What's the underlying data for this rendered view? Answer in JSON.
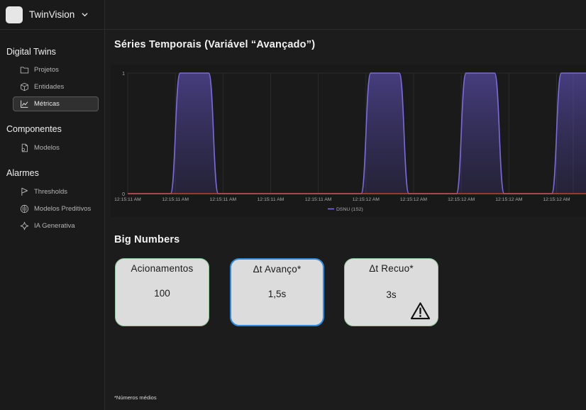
{
  "app": {
    "name": "TwinVision"
  },
  "sidebar": {
    "sections": [
      {
        "title": "Digital Twins",
        "items": [
          {
            "label": "Projetos",
            "icon": "folder-icon"
          },
          {
            "label": "Entidades",
            "icon": "cube-icon"
          },
          {
            "label": "Métricas",
            "icon": "line-chart-icon",
            "active": true
          }
        ]
      },
      {
        "title": "Componentes",
        "items": [
          {
            "label": "Modelos",
            "icon": "model-file-icon"
          }
        ]
      },
      {
        "title": "Alarmes",
        "items": [
          {
            "label": "Thresholds",
            "icon": "flag-icon"
          },
          {
            "label": "Modelos Preditivos",
            "icon": "brain-icon"
          },
          {
            "label": "IA Generativa",
            "icon": "sparkle-icon"
          }
        ]
      }
    ]
  },
  "timeseries": {
    "title": "Séries Temporais (Variável “Avançado”)"
  },
  "chart_data": {
    "type": "line",
    "y_ticks": [
      "0",
      "1"
    ],
    "ylim": [
      0,
      1
    ],
    "x_ticks": [
      "12:15:11 AM",
      "12:15:11 AM",
      "12:15:11 AM",
      "12:15:11 AM",
      "12:15:11 AM",
      "12:15:12 AM",
      "12:15:12 AM",
      "12:15:12 AM",
      "12:15:12 AM",
      "12:15:12 AM"
    ],
    "grid": true,
    "legend_position": "bottom",
    "series": [
      {
        "name": "DSNU (1S2)",
        "color": "#7b6ad8",
        "fill": true,
        "x": [
          0,
          0.9,
          1.1,
          1.7,
          1.9,
          4.9,
          5.1,
          5.7,
          5.9,
          6.9,
          7.1,
          7.7,
          7.9,
          8.9,
          9.1,
          9.65
        ],
        "y": [
          0,
          0,
          1,
          1,
          0,
          0,
          1,
          1,
          0,
          0,
          1,
          1,
          0,
          0,
          1,
          1
        ]
      },
      {
        "color": "#e04a3c",
        "fill": false,
        "x": [
          0,
          9.65
        ],
        "y": [
          0,
          0
        ]
      }
    ]
  },
  "big_numbers": {
    "title": "Big Numbers",
    "cards": [
      {
        "label": "Acionamentos",
        "value": "100"
      },
      {
        "label": "Δt Avanço*",
        "value": "1,5s",
        "selected": true
      },
      {
        "label": "Δt Recuo*",
        "value": "3s",
        "warning_icon": "warning-triangle-icon"
      }
    ]
  },
  "footnote": "*Números médios"
}
